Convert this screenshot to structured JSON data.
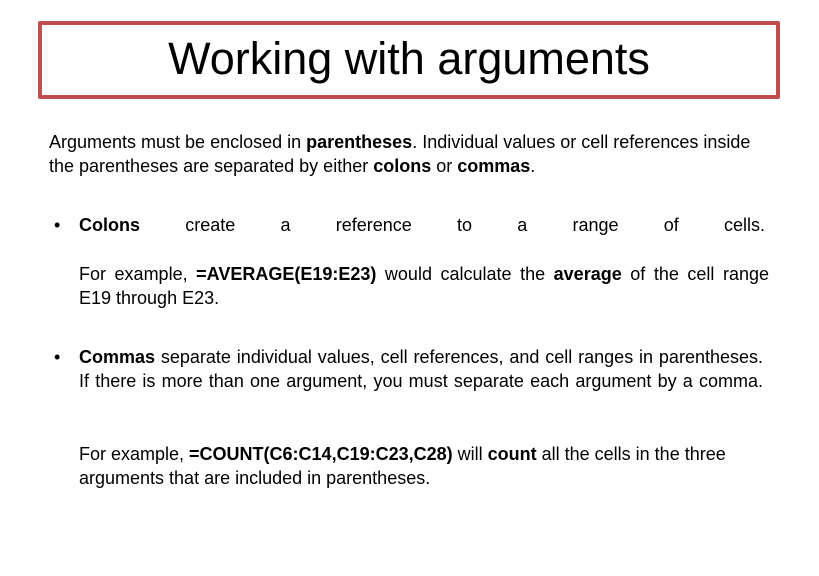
{
  "title": "Working with arguments",
  "border_color": "#c0504d",
  "intro": {
    "t1": "Arguments must be enclosed in ",
    "b1": "parentheses",
    "t2": ". Individual values or cell references inside the parentheses are separated by either ",
    "b2": "colons",
    "t3": " or ",
    "b3": "commas",
    "t4": "."
  },
  "bullets": [
    {
      "marker": "•",
      "bold": "Colons",
      "text": " create a reference to a range of cells."
    },
    {
      "marker": "•",
      "bold": "Commas",
      "text": " separate individual values, cell references, and cell ranges in parentheses. If there is more than one argument, you must separate each argument by a comma."
    }
  ],
  "examples": [
    {
      "t1": "For example, ",
      "b1": "=AVERAGE(E19:E23)",
      "t2": " would calculate the ",
      "b2": "average",
      "t3": " of the cell range E19 through E23."
    },
    {
      "t1": "For example, ",
      "b1": "=COUNT(C6:C14,C19:C23,C28)",
      "t2": " will ",
      "b2": "count",
      "t3": " all the cells in the three arguments that are included in parentheses."
    }
  ]
}
